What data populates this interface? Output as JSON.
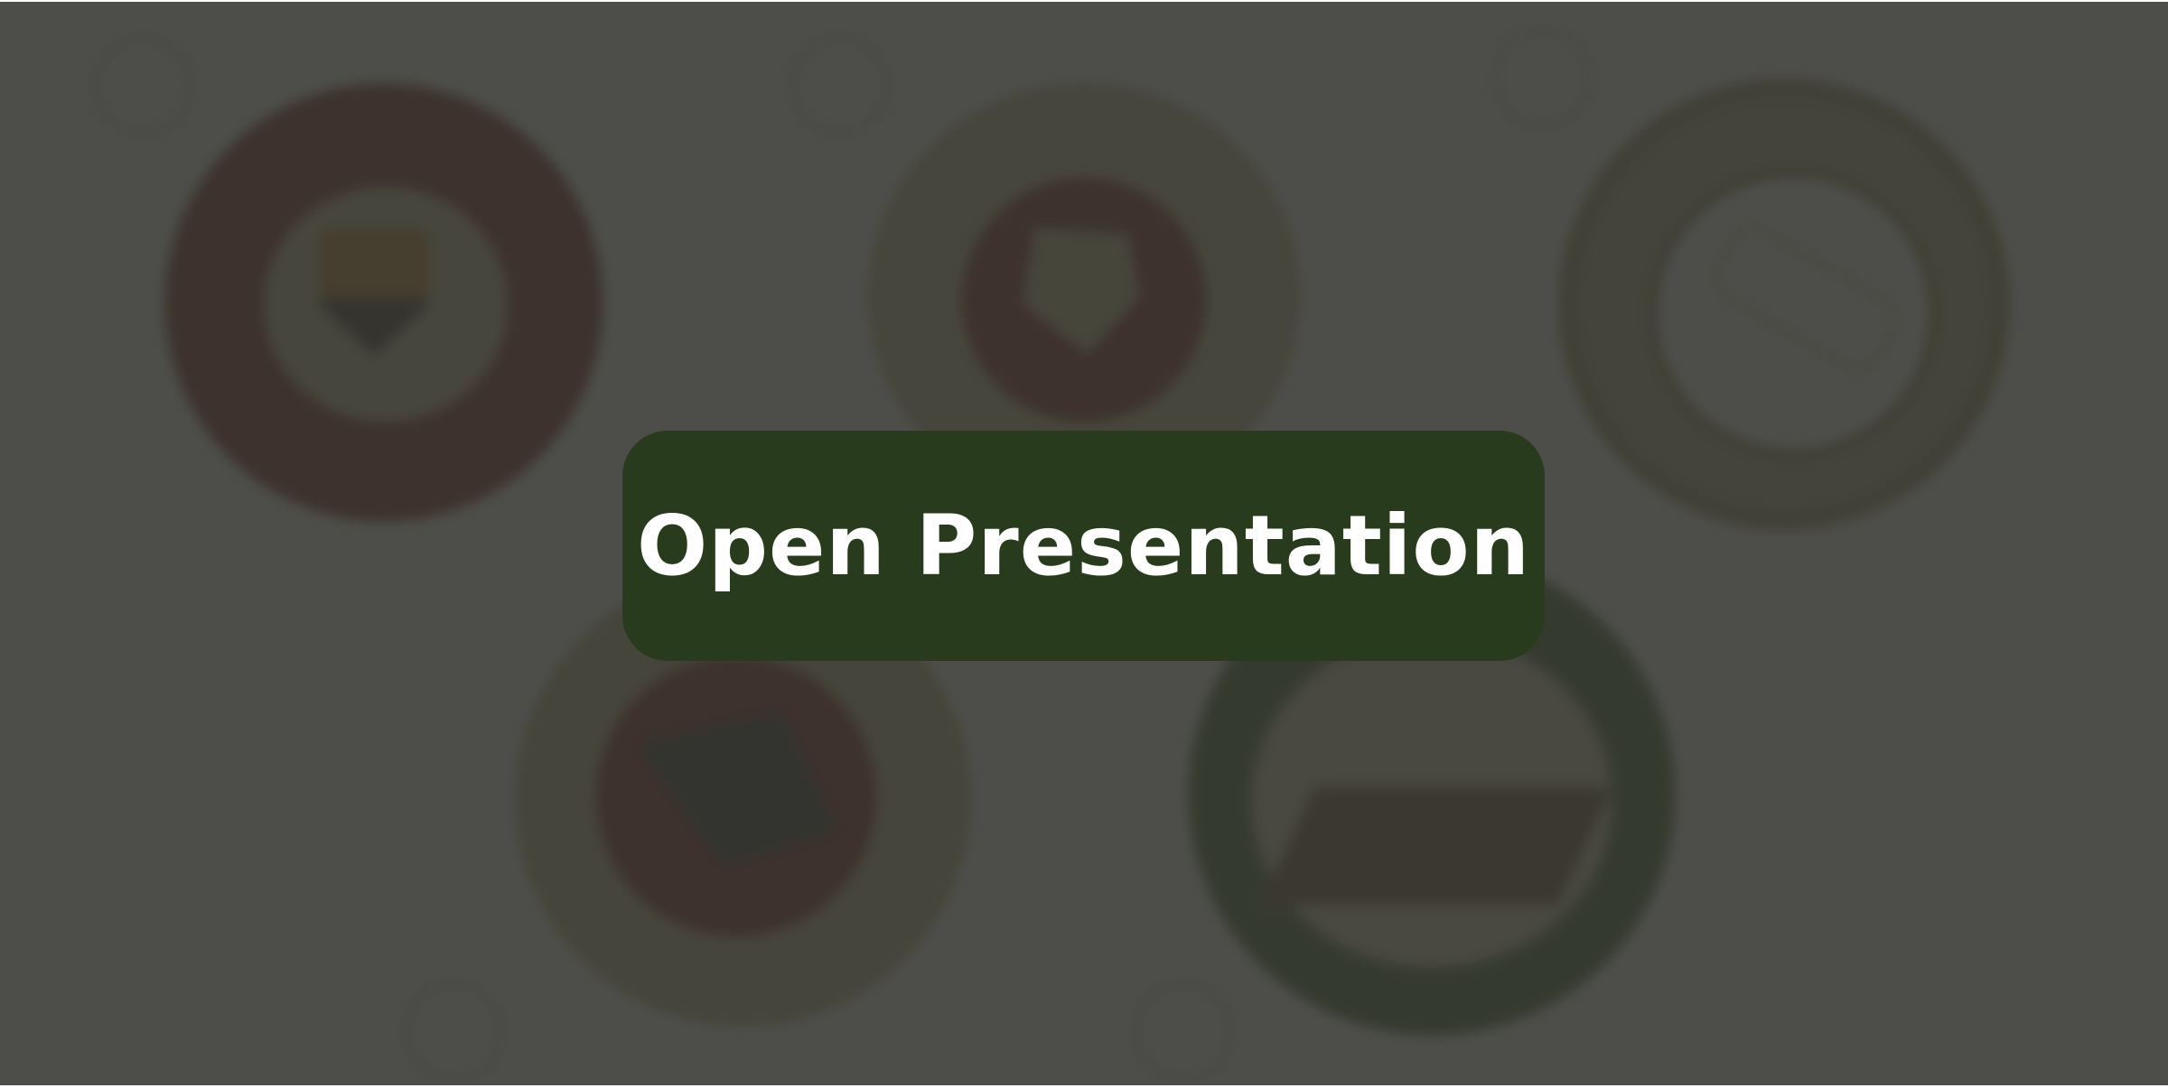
{
  "open_button": {
    "label": "Open Presentation"
  },
  "colors": {
    "button_bg": "#283b1d",
    "button_text": "#ffffff",
    "overlay": "#434440"
  },
  "background_badges": [
    {
      "name": "badge-crest-red"
    },
    {
      "name": "badge-shield-tan"
    },
    {
      "name": "badge-logs-white"
    },
    {
      "name": "badge-bricks-red"
    },
    {
      "name": "badge-house-green"
    }
  ]
}
